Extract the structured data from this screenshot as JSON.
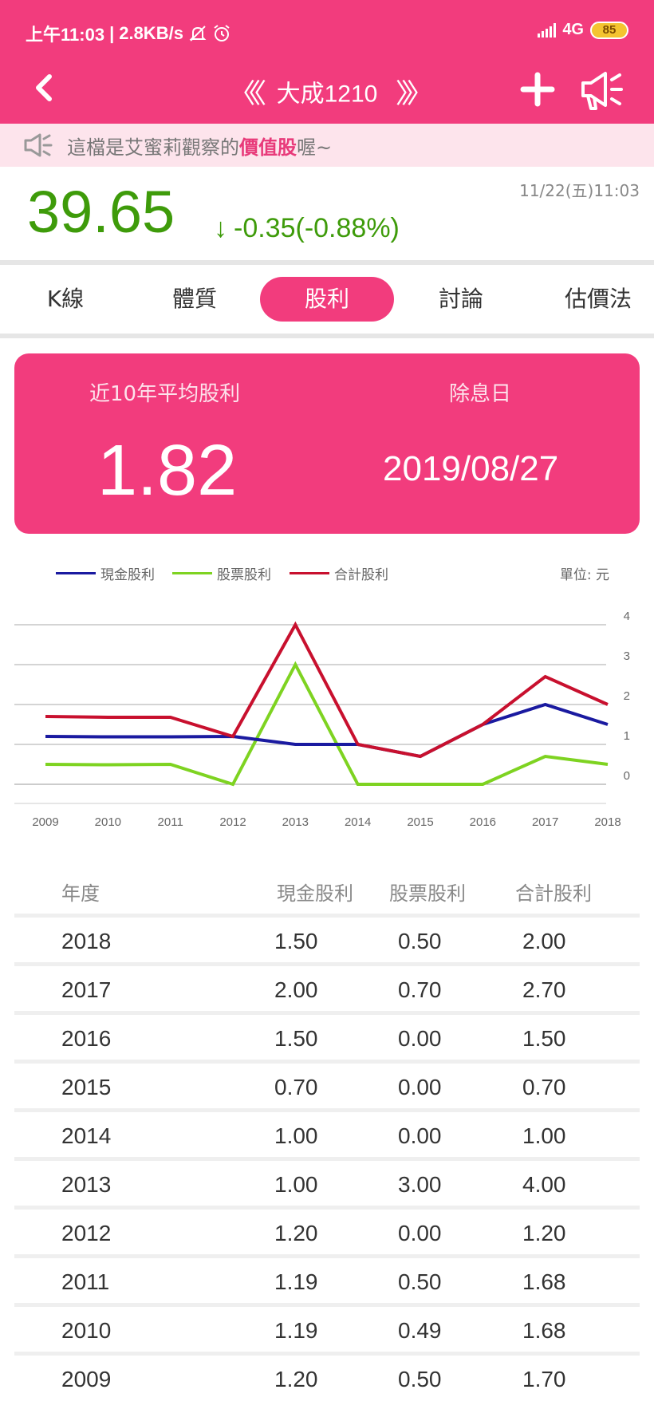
{
  "status_bar": {
    "time": "上午11:03",
    "speed": "2.8KB/s",
    "network": "4G",
    "battery": "85"
  },
  "nav": {
    "title": "大成1210"
  },
  "notice": {
    "prefix": "這檔是艾蜜莉觀察的",
    "highlight": "價值股",
    "suffix": "喔~"
  },
  "quote": {
    "price": "39.65",
    "change": "-0.35(-0.88%)",
    "timestamp": "11/22(五)11:03",
    "color": "#3e9b0a"
  },
  "tabs": [
    {
      "label": "K線"
    },
    {
      "label": "體質"
    },
    {
      "label": "股利",
      "active": true
    },
    {
      "label": "討論"
    },
    {
      "label": "估價法"
    }
  ],
  "summary": {
    "avg_label": "近10年平均股利",
    "avg_value": "1.82",
    "exdiv_label": "除息日",
    "exdiv_date": "2019/08/27"
  },
  "legend": {
    "unit": "單位: 元"
  },
  "chart_data": {
    "type": "line",
    "x": [
      "2009",
      "2010",
      "2011",
      "2012",
      "2013",
      "2014",
      "2015",
      "2016",
      "2017",
      "2018"
    ],
    "ylim": [
      0,
      4
    ],
    "yticks": [
      "0",
      "1",
      "2",
      "3",
      "4"
    ],
    "grid": true,
    "series": [
      {
        "name": "現金股利",
        "color": "#1a1aa0",
        "values": [
          1.2,
          1.19,
          1.19,
          1.2,
          1.0,
          1.0,
          0.7,
          1.5,
          2.0,
          1.5
        ]
      },
      {
        "name": "股票股利",
        "color": "#7ed321",
        "values": [
          0.5,
          0.49,
          0.5,
          0.0,
          3.0,
          0.0,
          0.0,
          0.0,
          0.7,
          0.5
        ]
      },
      {
        "name": "合計股利",
        "color": "#c8102e",
        "values": [
          1.7,
          1.68,
          1.68,
          1.2,
          4.0,
          1.0,
          0.7,
          1.5,
          2.7,
          2.0
        ]
      }
    ]
  },
  "table": {
    "headers": [
      "年度",
      "現金股利",
      "股票股利",
      "合計股利"
    ],
    "rows": [
      [
        "2018",
        "1.50",
        "0.50",
        "2.00"
      ],
      [
        "2017",
        "2.00",
        "0.70",
        "2.70"
      ],
      [
        "2016",
        "1.50",
        "0.00",
        "1.50"
      ],
      [
        "2015",
        "0.70",
        "0.00",
        "0.70"
      ],
      [
        "2014",
        "1.00",
        "0.00",
        "1.00"
      ],
      [
        "2013",
        "1.00",
        "3.00",
        "4.00"
      ],
      [
        "2012",
        "1.20",
        "0.00",
        "1.20"
      ],
      [
        "2011",
        "1.19",
        "0.50",
        "1.68"
      ],
      [
        "2010",
        "1.19",
        "0.49",
        "1.68"
      ],
      [
        "2009",
        "1.20",
        "0.50",
        "1.70"
      ]
    ]
  }
}
